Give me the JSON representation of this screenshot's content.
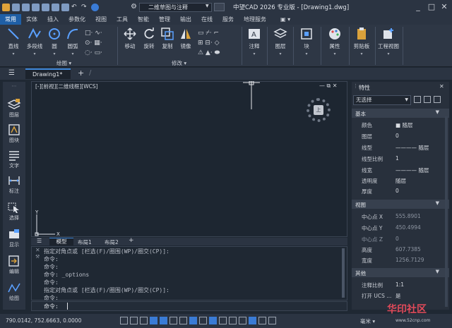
{
  "title": {
    "text": "中望CAD 2026 专业版 - [Drawing1.dwg]",
    "workspace": "二维草图与注释"
  },
  "menu": [
    "常用",
    "实体",
    "插入",
    "参数化",
    "视图",
    "工具",
    "智能",
    "管理",
    "输出",
    "在线",
    "服务",
    "地理服务"
  ],
  "ribbon": {
    "buttons": [
      {
        "label": "直线"
      },
      {
        "label": "多段线"
      },
      {
        "label": "圆"
      },
      {
        "label": "圆弧"
      },
      {
        "label": "移动"
      },
      {
        "label": "旋转"
      },
      {
        "label": "复制"
      },
      {
        "label": "镜像"
      },
      {
        "label": "注释"
      },
      {
        "label": "图层"
      },
      {
        "label": "块"
      },
      {
        "label": "属性"
      },
      {
        "label": "剪贴板"
      },
      {
        "label": "工程视图"
      }
    ],
    "groups": {
      "draw": "绘图",
      "modify": "修改"
    }
  },
  "tabs": {
    "doc": "Drawing1*"
  },
  "viewport_label": "[-][前视][二维线框][WCS]",
  "cube_face": "上",
  "left_tools": [
    "图层",
    "图块",
    "文字",
    "标注",
    "选择",
    "显示",
    "编辑",
    "绘图"
  ],
  "layout_tabs": [
    "模型",
    "布局1",
    "布局2"
  ],
  "commands": [
    "指定对角点或 [栏选(F)/圈围(WP)/圈交(CP)]:",
    "命令:",
    "命令:",
    "命令: _options",
    "命令:",
    "指定对角点或 [栏选(F)/圈围(WP)/圈交(CP)]:",
    "命令:"
  ],
  "command_prompt": "命令:",
  "properties": {
    "title": "特性",
    "selection": "无选择",
    "sections": {
      "basic": "基本",
      "view": "视图",
      "other": "其他"
    },
    "basic": [
      {
        "k": "颜色",
        "v": "■ 随层"
      },
      {
        "k": "图层",
        "v": "0"
      },
      {
        "k": "线型",
        "v": "———— 随层"
      },
      {
        "k": "线型比例",
        "v": "1"
      },
      {
        "k": "线宽",
        "v": "———— 随层"
      },
      {
        "k": "透明度",
        "v": "随层"
      },
      {
        "k": "厚度",
        "v": "0"
      }
    ],
    "view": [
      {
        "k": "中心点 X",
        "v": "555.8901"
      },
      {
        "k": "中心点 Y",
        "v": "450.4994"
      },
      {
        "k": "中心点 Z",
        "v": "0"
      },
      {
        "k": "高度",
        "v": "607.7385"
      },
      {
        "k": "宽度",
        "v": "1256.7129"
      }
    ],
    "other": [
      {
        "k": "注释比例",
        "v": "1:1"
      },
      {
        "k": "打开 UCS ...",
        "v": "是"
      }
    ]
  },
  "status": {
    "coords": "790.0142,  752.6663,  0.0000",
    "units": "毫米",
    "watermark": "华印社区",
    "watermark_sub": "www.52cnp.com"
  },
  "colors": {
    "accent": "#1f5fa6",
    "panel": "#28303c",
    "canvas": "#1d2631"
  }
}
